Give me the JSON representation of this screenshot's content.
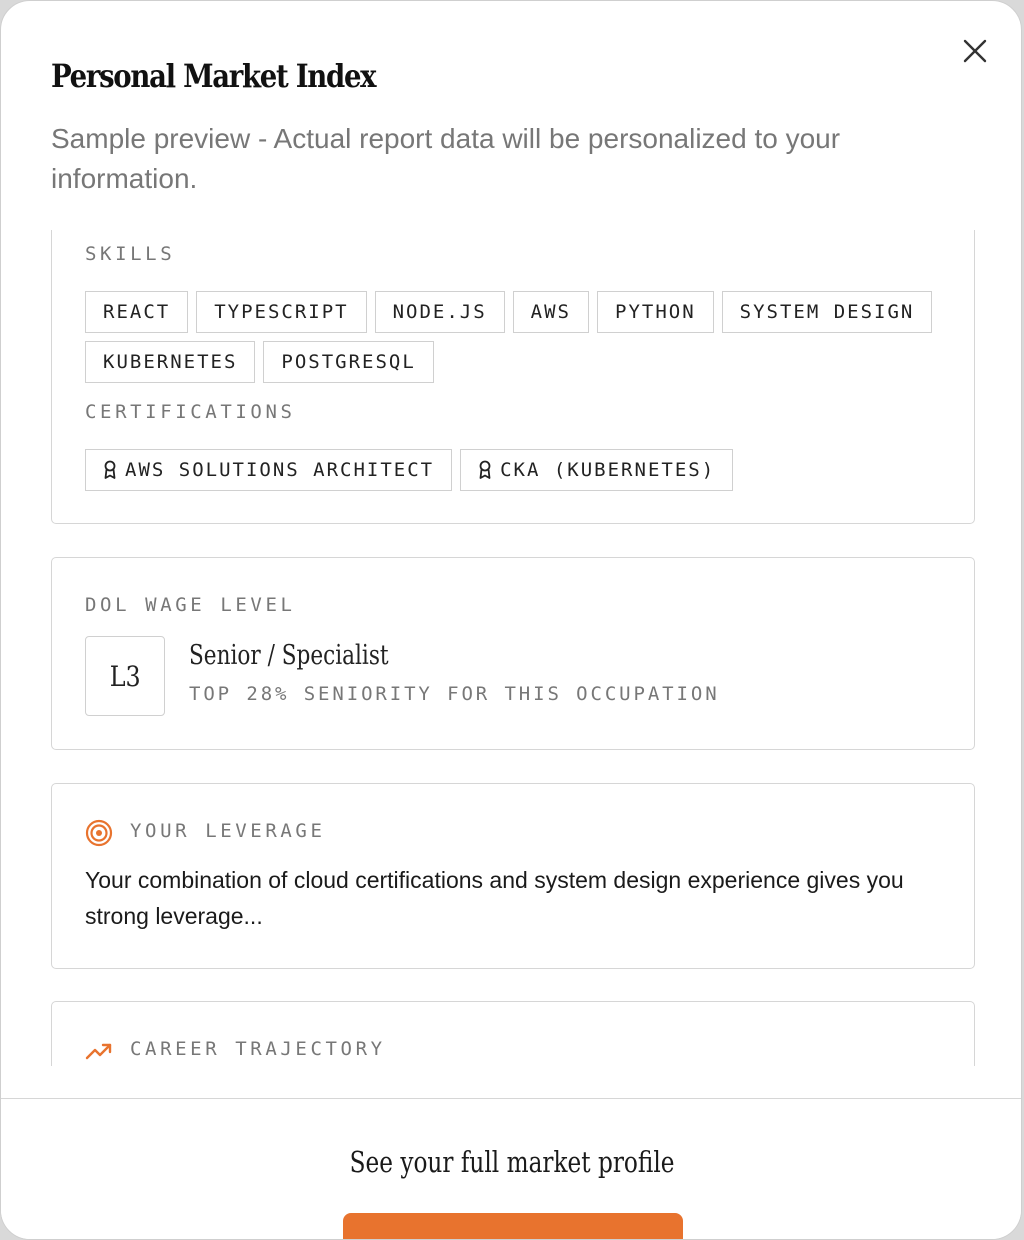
{
  "modal": {
    "title": "Personal Market Index",
    "subtitle": "Sample preview - Actual report data will be personalized to your information.",
    "close_icon": "close-icon"
  },
  "skills_card": {
    "skills_label": "SKILLS",
    "skills": [
      "REACT",
      "TYPESCRIPT",
      "NODE.JS",
      "AWS",
      "PYTHON",
      "SYSTEM DESIGN",
      "KUBERNETES",
      "POSTGRESQL"
    ],
    "certifications_label": "CERTIFICATIONS",
    "certifications": [
      "AWS SOLUTIONS ARCHITECT",
      "CKA (KUBERNETES)"
    ],
    "certification_icon": "award-ribbon-icon"
  },
  "wage_card": {
    "label": "DOL WAGE LEVEL",
    "level": "L3",
    "level_name": "Senior / Specialist",
    "level_detail": "TOP 28% SENIORITY FOR THIS OCCUPATION"
  },
  "leverage_card": {
    "icon": "target-icon",
    "label": "YOUR LEVERAGE",
    "text": "Your combination of cloud certifications and system design experience gives you strong leverage..."
  },
  "trajectory_card": {
    "icon": "trending-up-icon",
    "label": "CAREER TRAJECTORY"
  },
  "footer": {
    "title": "See your full market profile"
  },
  "colors": {
    "accent": "#e8732e",
    "border": "#d6d6d6",
    "muted_text": "#777777"
  }
}
